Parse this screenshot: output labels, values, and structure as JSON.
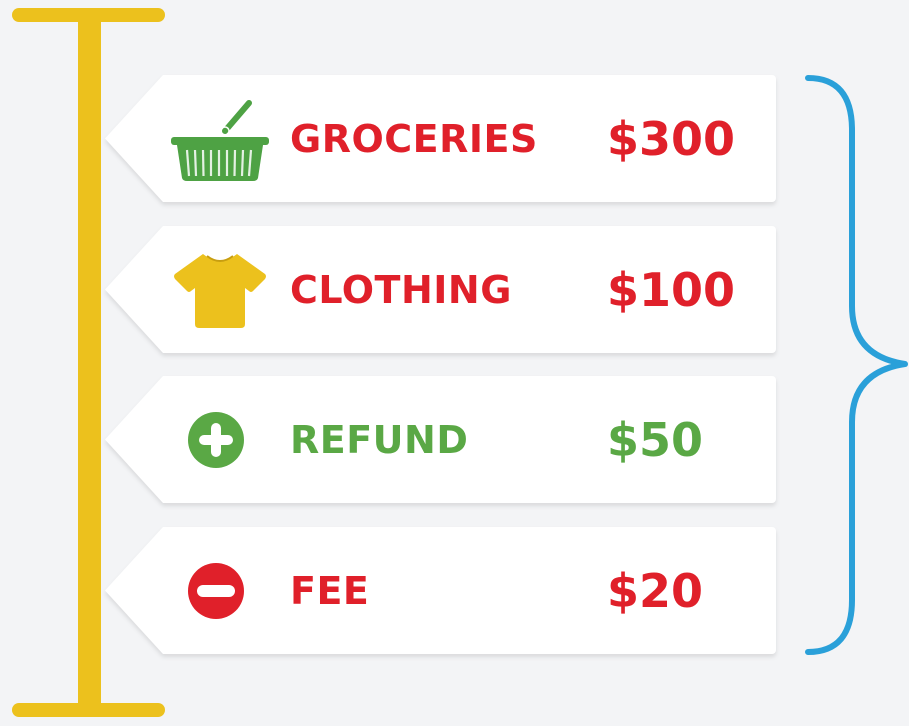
{
  "colors": {
    "timeline": "#ecc11d",
    "expense": "#e0202a",
    "income": "#5aa845",
    "brace": "#2aa0d9",
    "basket": "#4ea244",
    "shirt": "#ecc11d"
  },
  "items": [
    {
      "label": "GROCERIES",
      "amount": "$300",
      "icon": "basket-icon",
      "kind": "expense"
    },
    {
      "label": "CLOTHING",
      "amount": "$100",
      "icon": "shirt-icon",
      "kind": "expense"
    },
    {
      "label": "REFUND",
      "amount": "$50",
      "icon": "plus-circle-icon",
      "kind": "income"
    },
    {
      "label": "FEE",
      "amount": "$20",
      "icon": "minus-circle-icon",
      "kind": "expense"
    }
  ]
}
